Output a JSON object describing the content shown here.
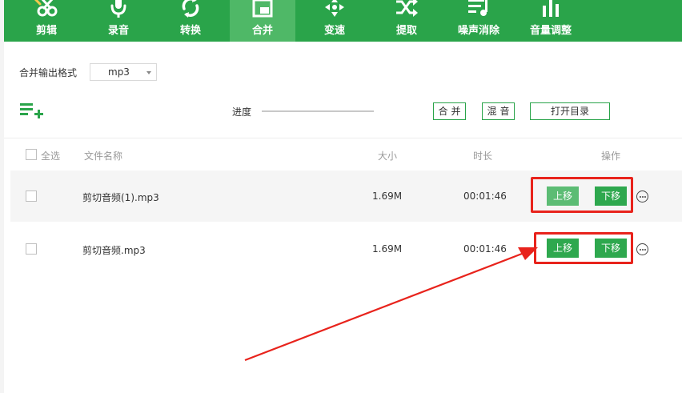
{
  "toolbar": {
    "items": [
      {
        "label": "剪辑",
        "icon": "scissors-icon"
      },
      {
        "label": "录音",
        "icon": "microphone-icon"
      },
      {
        "label": "转换",
        "icon": "convert-icon"
      },
      {
        "label": "合并",
        "icon": "merge-icon",
        "active": true
      },
      {
        "label": "变速",
        "icon": "speed-icon"
      },
      {
        "label": "提取",
        "icon": "shuffle-icon"
      },
      {
        "label": "噪声消除",
        "icon": "noise-reduction-icon"
      },
      {
        "label": "音量调整",
        "icon": "volume-bars-icon"
      }
    ]
  },
  "format": {
    "label": "合并输出格式",
    "value": "mp3"
  },
  "actions": {
    "progress_label": "进度",
    "progress": 0,
    "merge": "合并",
    "mix": "混音",
    "open_dir": "打开目录"
  },
  "table": {
    "headers": {
      "select_all": "全选",
      "filename": "文件名称",
      "size": "大小",
      "duration": "时长",
      "operation": "操作"
    },
    "rows": [
      {
        "name": "剪切音频(1).mp3",
        "size": "1.69M",
        "duration": "00:01:46",
        "up": "上移",
        "down": "下移"
      },
      {
        "name": "剪切音频.mp3",
        "size": "1.69M",
        "duration": "00:01:46",
        "up": "上移",
        "down": "下移"
      }
    ]
  },
  "colors": {
    "brand": "#2aa44a",
    "active_tab": "#4fb867",
    "annotation": "#e8231c"
  }
}
